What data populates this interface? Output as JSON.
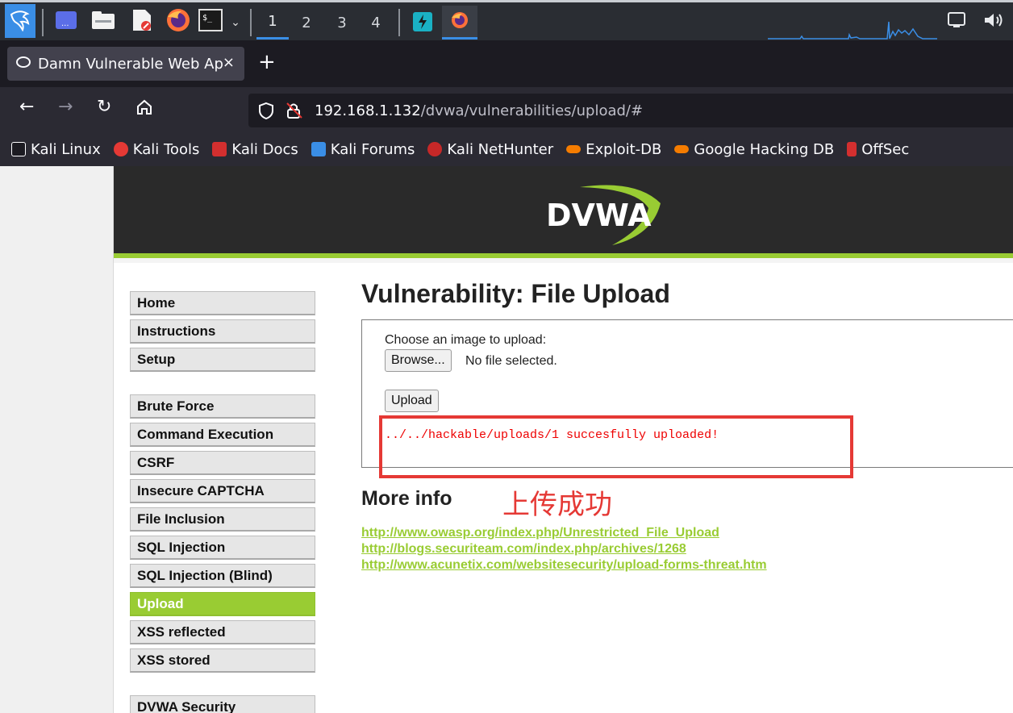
{
  "colors": {
    "panel_bg": "#2a2d33",
    "browser_bg": "#2b2a33",
    "dvwa_header": "#2a2a2a",
    "dvwa_accent": "#99cc33",
    "error_red": "#ee0000",
    "annotation_red": "#e53935"
  },
  "panel": {
    "icons": [
      "kali-dragon-icon",
      "desktop-icon",
      "file-manager-icon",
      "text-editor-icon",
      "firefox-icon",
      "terminal-icon",
      "chevron-down-icon",
      "tray-app-icon",
      "firefox-taskbar-icon",
      "display-icon",
      "volume-icon"
    ],
    "workspaces": [
      "1",
      "2",
      "3",
      "4"
    ]
  },
  "browser": {
    "tab_title": "Damn Vulnerable Web App",
    "tab_close": "×",
    "new_tab": "+",
    "url_host": "192.168.1.132",
    "url_path": "/dvwa/vulnerabilities/upload/#",
    "bookmarks": [
      {
        "label": "Kali Linux",
        "color": "#2a2a2a"
      },
      {
        "label": "Kali Tools",
        "color": "#e53935"
      },
      {
        "label": "Kali Docs",
        "color": "#d32f2f"
      },
      {
        "label": "Kali Forums",
        "color": "#3a8ee6"
      },
      {
        "label": "Kali NetHunter",
        "color": "#c62828"
      },
      {
        "label": "Exploit-DB",
        "color": "#f57c00"
      },
      {
        "label": "Google Hacking DB",
        "color": "#f57c00"
      },
      {
        "label": "OffSec",
        "color": "#d32f2f"
      }
    ]
  },
  "dvwa": {
    "logo": "DVWA",
    "menu": {
      "home": "Home",
      "instructions": "Instructions",
      "setup": "Setup",
      "brute_force": "Brute Force",
      "command_execution": "Command Execution",
      "csrf": "CSRF",
      "insecure_captcha": "Insecure CAPTCHA",
      "file_inclusion": "File Inclusion",
      "sql_injection": "SQL Injection",
      "sql_injection_blind": "SQL Injection (Blind)",
      "upload": "Upload",
      "xss_reflected": "XSS reflected",
      "xss_stored": "XSS stored",
      "dvwa_security": "DVWA Security"
    },
    "title": "Vulnerability: File Upload",
    "upload_prompt": "Choose an image to upload:",
    "browse_label": "Browse...",
    "file_status": "No file selected.",
    "upload_label": "Upload",
    "success_message": "../../hackable/uploads/1 succesfully uploaded!",
    "annotation": "上传成功",
    "more_info": "More info",
    "links": [
      "http://www.owasp.org/index.php/Unrestricted_File_Upload",
      "http://blogs.securiteam.com/index.php/archives/1268",
      "http://www.acunetix.com/websitesecurity/upload-forms-threat.htm"
    ]
  }
}
